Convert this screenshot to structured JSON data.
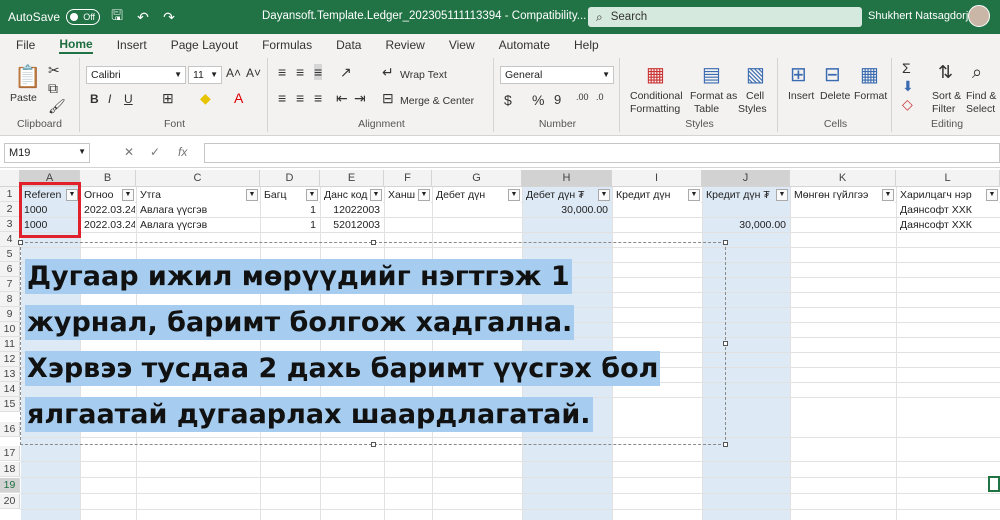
{
  "titlebar": {
    "autosave_label": "AutoSave",
    "autosave_state": "Off",
    "document_title": "Dayansoft.Template.Ledger_202305111113394  -  Compatibility...",
    "search_placeholder": "Search",
    "user_name": "Shukhert Natsagdorj"
  },
  "menu": {
    "tabs": [
      "File",
      "Home",
      "Insert",
      "Page Layout",
      "Formulas",
      "Data",
      "Review",
      "View",
      "Automate",
      "Help"
    ],
    "active_tab": "Home"
  },
  "ribbon": {
    "clipboard": {
      "label": "Clipboard",
      "paste": "Paste"
    },
    "font": {
      "label": "Font",
      "font_name": "Calibri",
      "font_size": "11"
    },
    "alignment": {
      "label": "Alignment",
      "wrap_text": "Wrap Text",
      "merge_center": "Merge & Center"
    },
    "number": {
      "label": "Number",
      "format": "General"
    },
    "styles": {
      "label": "Styles",
      "conditional": "Conditional",
      "conditional2": "Formatting",
      "format_as": "Format as",
      "table": "Table",
      "cell": "Cell",
      "cell_styles": "Styles"
    },
    "cells": {
      "label": "Cells",
      "insert": "Insert",
      "delete": "Delete",
      "format": "Format"
    },
    "editing": {
      "label": "Editing",
      "sort": "Sort &",
      "filter": "Filter",
      "find": "Find &",
      "select": "Select"
    }
  },
  "formula_bar": {
    "name_box": "M19",
    "fx": "fx",
    "content": ""
  },
  "sheet": {
    "columns": [
      "A",
      "B",
      "C",
      "D",
      "E",
      "F",
      "G",
      "H",
      "I",
      "J",
      "K",
      "L"
    ],
    "rows": [
      "1",
      "2",
      "3",
      "4",
      "5",
      "6",
      "7",
      "8",
      "9",
      "10",
      "11",
      "12",
      "13",
      "14",
      "15",
      "16",
      "17",
      "18",
      "19",
      "20"
    ],
    "headers": [
      "Referen",
      "Огноо",
      "Утга",
      "Багц",
      "Данс код",
      "Ханш",
      "Дебет дүн",
      "Дебет дүн ₮",
      "Кредит дүн",
      "Кредит дүн ₮",
      "Мөнгөн гүйлгээ",
      "Харилцагч нэр"
    ],
    "row2": {
      "A": "1000",
      "B": "2022.03.24",
      "C": "Авлага үүсгэв",
      "D": "1",
      "E": "12022003",
      "H": "30,000.00",
      "L": "Даянсофт ХХК"
    },
    "row3": {
      "A": "1000",
      "B": "2022.03.24",
      "C": "Авлага үүсгэв",
      "D": "1",
      "E": "52012003",
      "J": "30,000.00",
      "L": "Даянсофт ХХК"
    }
  },
  "overlay_text": {
    "line1": "Дугаар ижил мөрүүдийг нэгтгэж 1",
    "line2": "журнал, баримт болгож хадгална.",
    "line3": "Хэрвээ тусдаа 2 дахь баримт үүсгэх бол",
    "line4": "ялгаатай дугаарлах шаардлагатай."
  },
  "colors": {
    "excel_green": "#217346",
    "selection_blue": "#dde9f5",
    "highlight": "#a6cdef",
    "red_box": "#e0202a"
  }
}
